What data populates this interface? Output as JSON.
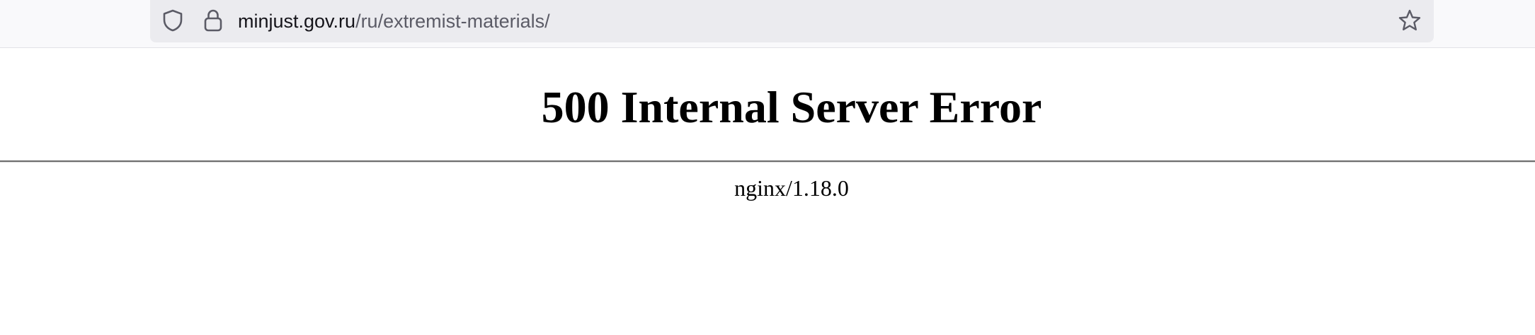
{
  "browser": {
    "url_host": "minjust.gov.ru",
    "url_path": "/ru/extremist-materials/",
    "icons": {
      "tracking_protection": "shield-icon",
      "site_security": "lock-icon",
      "bookmark": "star-icon"
    }
  },
  "page": {
    "title": "500 Internal Server Error",
    "server": "nginx/1.18.0"
  },
  "colors": {
    "toolbar_bg": "#f9f9fb",
    "urlbar_bg": "#ebebef",
    "url_host": "#15141a",
    "url_path": "#5b5b66",
    "text": "#000000"
  }
}
